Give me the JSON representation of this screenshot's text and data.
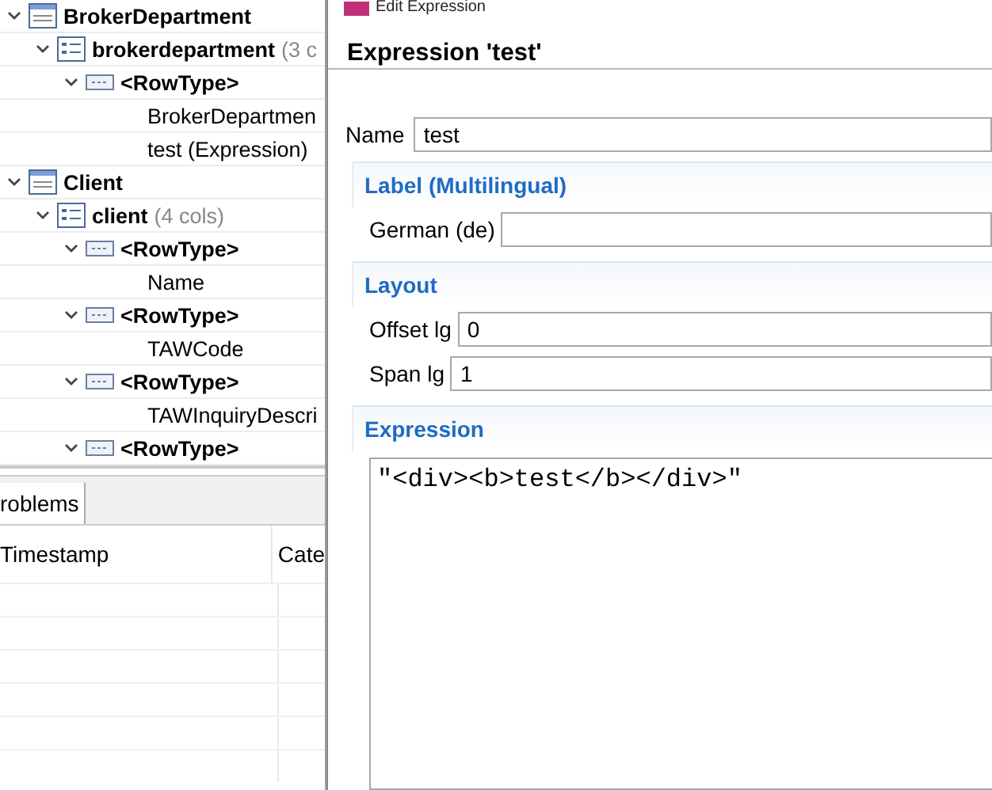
{
  "tree": [
    {
      "kind": "table",
      "label": "BrokerDepartment",
      "expanded": true,
      "children": [
        {
          "kind": "structure",
          "label": "brokerdepartment",
          "suffix": "(3 c",
          "expanded": true,
          "children": [
            {
              "kind": "rowtype",
              "label": "<RowType>",
              "expanded": true,
              "children": [
                {
                  "kind": "field",
                  "label": "BrokerDepartmen"
                },
                {
                  "kind": "field",
                  "label": "test (Expression)"
                }
              ]
            }
          ]
        }
      ]
    },
    {
      "kind": "table",
      "label": "Client",
      "expanded": true,
      "children": [
        {
          "kind": "structure",
          "label": "client",
          "suffix": "(4 cols)",
          "expanded": true,
          "children": [
            {
              "kind": "rowtype",
              "label": "<RowType>",
              "expanded": true,
              "children": [
                {
                  "kind": "field",
                  "label": "Name"
                }
              ]
            },
            {
              "kind": "rowtype",
              "label": "<RowType>",
              "expanded": true,
              "children": [
                {
                  "kind": "field",
                  "label": "TAWCode"
                }
              ]
            },
            {
              "kind": "rowtype",
              "label": "<RowType>",
              "expanded": true,
              "children": [
                {
                  "kind": "field",
                  "label": "TAWInquiryDescri"
                }
              ]
            },
            {
              "kind": "rowtype",
              "label": "<RowType>",
              "expanded": true
            }
          ]
        }
      ]
    }
  ],
  "bottom_panel": {
    "tabs": [
      {
        "label": "roblems",
        "selected": true
      }
    ],
    "columns": [
      "Timestamp",
      "Cate"
    ]
  },
  "dialog": {
    "window_title": "Edit Expression",
    "header": "Expression 'test'",
    "name": {
      "label": "Name",
      "value": "test"
    },
    "sections": [
      {
        "title": "Label (Multilingual)",
        "fields": [
          {
            "kind": "input",
            "label": "German (de)"
          }
        ]
      },
      {
        "title": "Layout",
        "fields": [
          {
            "kind": "input",
            "label": "Offset lg",
            "value": "0"
          },
          {
            "kind": "input",
            "label": "Span lg",
            "value": "1"
          }
        ]
      },
      {
        "title": "Expression",
        "fields": [
          {
            "kind": "code",
            "value": "\"<div><b>test</b></div>\""
          }
        ]
      }
    ]
  }
}
